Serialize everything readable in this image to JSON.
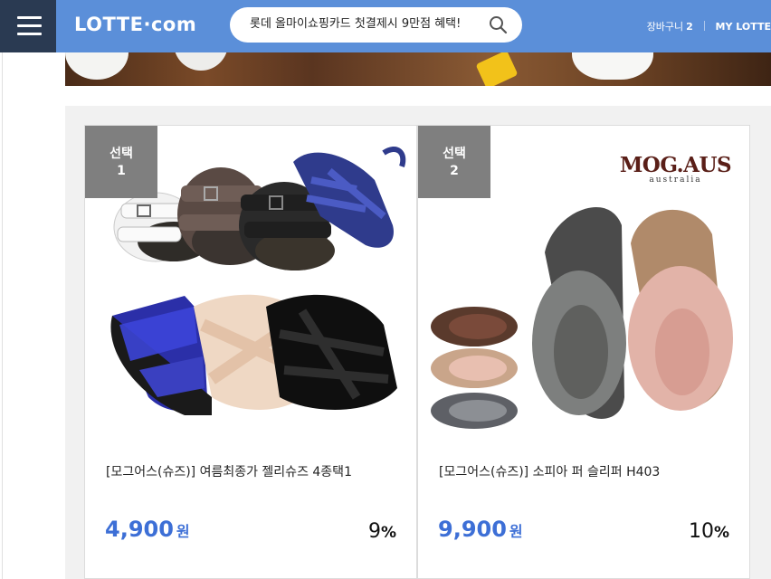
{
  "header": {
    "logo": "LOTTE·com",
    "search_value": "롯데 올마이쇼핑카드 첫결제시 9만점 혜택!",
    "cart_label": "장바구니",
    "cart_count": "2",
    "my_lotte": "MY LOTTE"
  },
  "products": [
    {
      "badge_line1": "선택",
      "badge_line2": "1",
      "title": "[모그어스(슈즈)] 여름최종가 젤리슈즈 4종택1",
      "price": "4,900",
      "price_unit": "원",
      "discount": "9",
      "discount_unit": "%"
    },
    {
      "badge_line1": "선택",
      "badge_line2": "2",
      "brand": "MOG.AUS",
      "brand_sub": "australia",
      "title": "[모그어스(슈즈)] 소피아 퍼 슬리퍼 H403",
      "price": "9,900",
      "price_unit": "원",
      "discount": "10",
      "discount_unit": "%"
    }
  ],
  "colors": {
    "header_bg": "#5b8fd9",
    "menu_bg": "#2a3a52",
    "price": "#3d6fd6",
    "badge": "#7f7f7f"
  }
}
